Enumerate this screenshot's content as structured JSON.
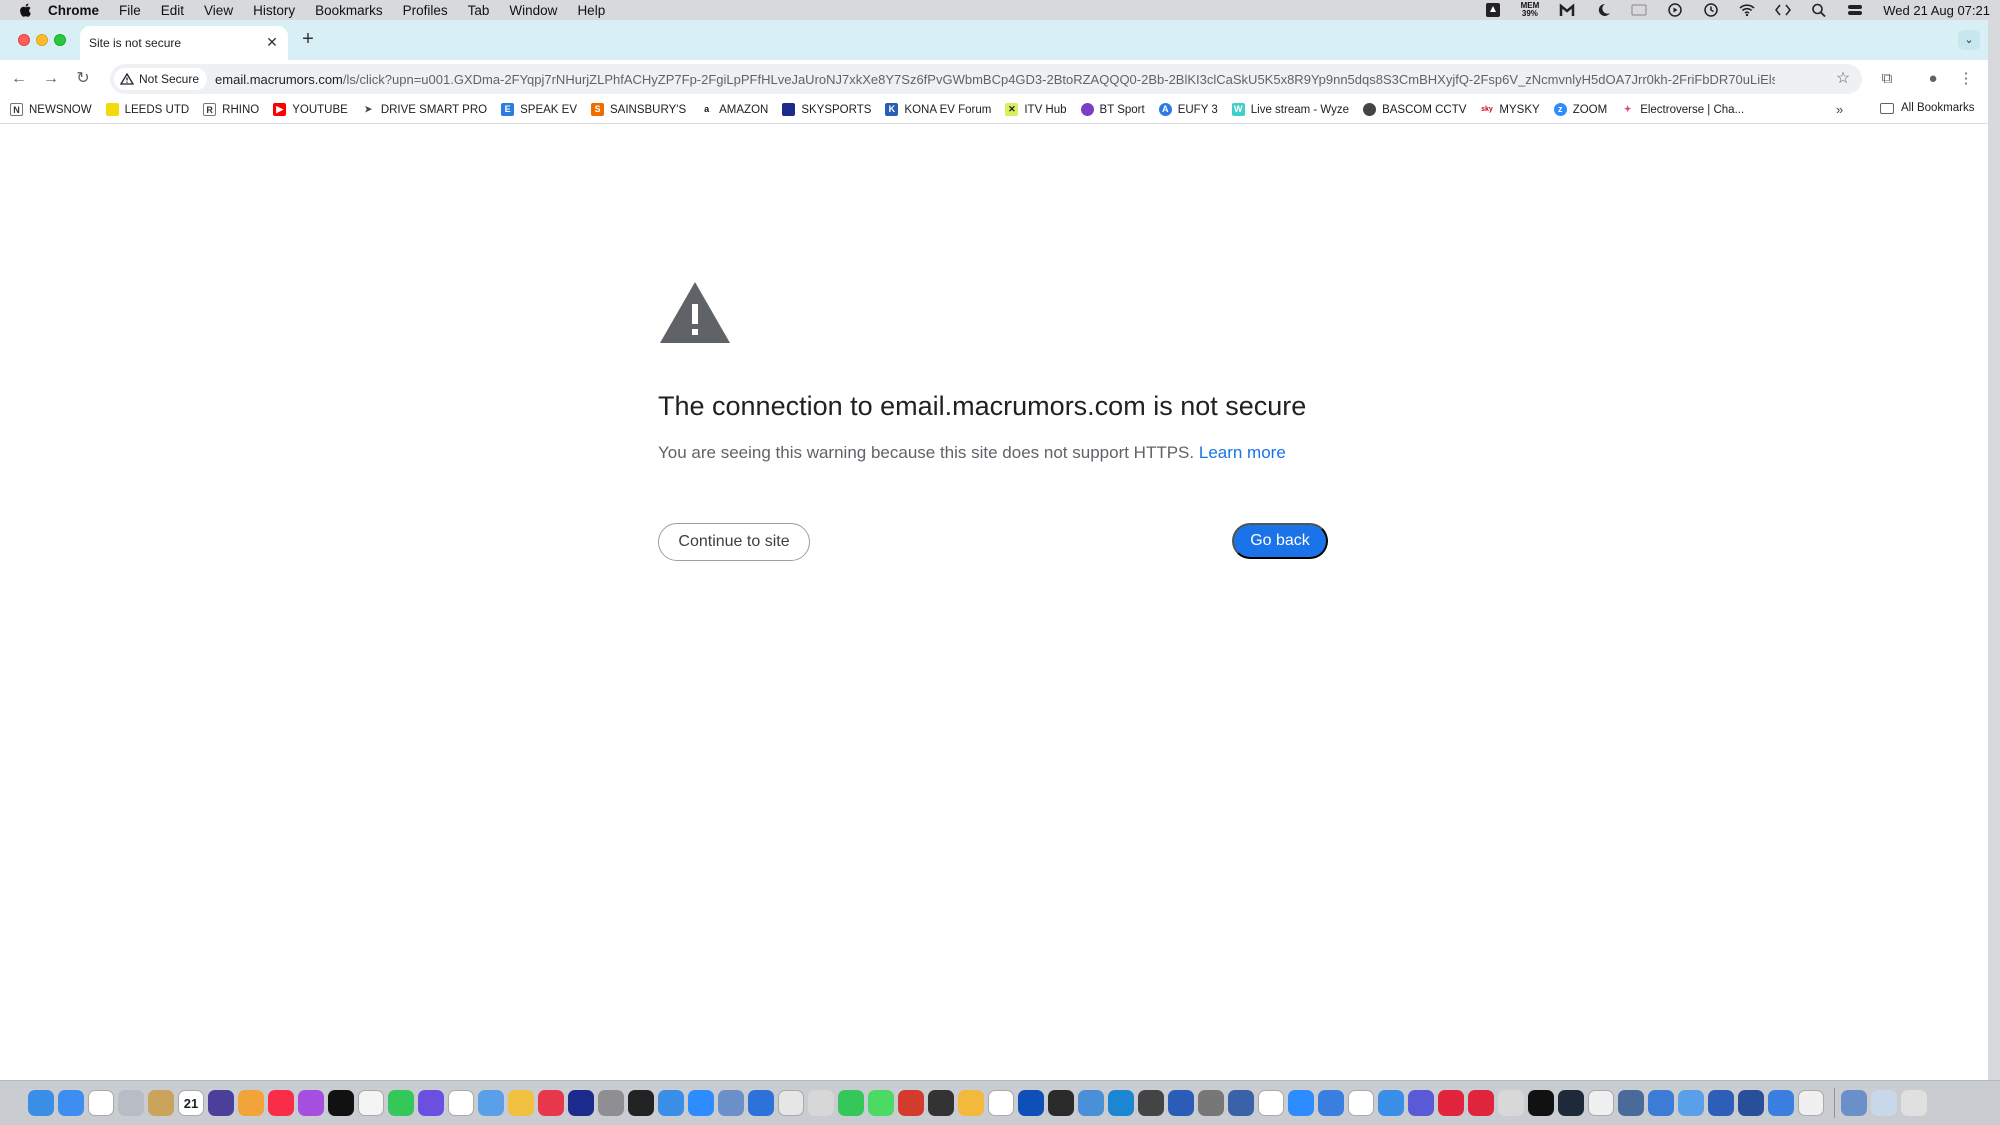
{
  "menubar": {
    "app": "Chrome",
    "items": [
      "File",
      "Edit",
      "View",
      "History",
      "Bookmarks",
      "Profiles",
      "Tab",
      "Window",
      "Help"
    ],
    "mem_label": "MEM",
    "mem_value": "39%",
    "clock": "Wed 21 Aug  07:21"
  },
  "tab": {
    "title": "Site is not secure"
  },
  "toolbar": {
    "security_chip": "Not Secure",
    "url_host": "email.macrumors.com",
    "url_path": "/ls/click?upn=u001.GXDma-2FYqpj7rNHurjZLPhfACHyZP7Fp-2FgiLpPFfHLveJaUroNJ7xkXe8Y7Sz6fPvGWbmBCp4GD3-2BtoRZAQQQ0-2Bb-2BlKI3clCaSkU5K5x8R9Yp9nn5dqs8S3CmBHXyjfQ-2Fsp6V_zNcmvnlyH5dOA7Jrr0kh-2FriFbDR70uLiElsEFY..."
  },
  "bookmarks": {
    "items": [
      {
        "label": "NEWSNOW",
        "color": "#ffffff",
        "glyph": "N",
        "glyph_color": "#333333"
      },
      {
        "label": "LEEDS UTD",
        "color": "#f5d90a",
        "glyph": "",
        "glyph_color": "#ffffff"
      },
      {
        "label": "RHINO",
        "color": "#ffffff",
        "glyph": "R",
        "glyph_color": "#333333"
      },
      {
        "label": "YOUTUBE",
        "color": "#ff0000",
        "glyph": "▶",
        "glyph_color": "#ffffff"
      },
      {
        "label": "DRIVE SMART PRO",
        "color": "#ffffff",
        "glyph": "➤",
        "glyph_color": "#444444"
      },
      {
        "label": "SPEAK EV",
        "color": "#2a7de1",
        "glyph": "E",
        "glyph_color": "#ffffff"
      },
      {
        "label": "SAINSBURY'S",
        "color": "#f06c00",
        "glyph": "S",
        "glyph_color": "#ffffff"
      },
      {
        "label": "AMAZON",
        "color": "#ffffff",
        "glyph": "a",
        "glyph_color": "#111111"
      },
      {
        "label": "SKYSPORTS",
        "color": "#1b2a8c",
        "glyph": "",
        "glyph_color": "#ffffff"
      },
      {
        "label": "KONA EV Forum",
        "color": "#2b5db8",
        "glyph": "K",
        "glyph_color": "#ffffff"
      },
      {
        "label": "ITV Hub",
        "color": "#d8f060",
        "glyph": "✕",
        "glyph_color": "#222222"
      },
      {
        "label": "BT Sport",
        "color": "#7b3fc4",
        "glyph": "",
        "glyph_color": "#ffffff"
      },
      {
        "label": "EUFY 3",
        "color": "#2c7be5",
        "glyph": "A",
        "glyph_color": "#ffffff"
      },
      {
        "label": "Live stream - Wyze",
        "color": "#3fd0c9",
        "glyph": "W",
        "glyph_color": "#ffffff"
      },
      {
        "label": "BASCOM CCTV",
        "color": "#444444",
        "glyph": "",
        "glyph_color": "#ffffff"
      },
      {
        "label": "MYSKY",
        "color": "#ffffff",
        "glyph": "sky",
        "glyph_color": "#d0021b"
      },
      {
        "label": "ZOOM",
        "color": "#2d8cff",
        "glyph": "z",
        "glyph_color": "#ffffff"
      },
      {
        "label": "Electroverse | Cha...",
        "color": "#ffffff",
        "glyph": "✦",
        "glyph_color": "#e0457b"
      }
    ],
    "more": "»",
    "all_bookmarks": "All Bookmarks"
  },
  "interstitial": {
    "heading": "The connection to email.macrumors.com is not secure",
    "explanation": "You are seeing this warning because this site does not support HTTPS.",
    "learn_more": "Learn more",
    "continue_label": "Continue to site",
    "back_label": "Go back"
  },
  "dock": {
    "calendar_day": "21",
    "icons": [
      {
        "name": "finder",
        "color": "#3a8ee6"
      },
      {
        "name": "mail",
        "color": "#3d8ef0"
      },
      {
        "name": "chrome",
        "color": "#ffffff"
      },
      {
        "name": "launchpad",
        "color": "#b8bcc4"
      },
      {
        "name": "archive",
        "color": "#c9a45a"
      },
      {
        "name": "calendar",
        "color": "#ffffff"
      },
      {
        "name": "siri",
        "color": "#4b3f9c"
      },
      {
        "name": "garageband",
        "color": "#f2a33a"
      },
      {
        "name": "music",
        "color": "#fa2d48"
      },
      {
        "name": "podcasts",
        "color": "#a54ee0"
      },
      {
        "name": "tv",
        "color": "#111111"
      },
      {
        "name": "notes",
        "color": "#f4f4f4"
      },
      {
        "name": "messages",
        "color": "#34c759"
      },
      {
        "name": "imovie",
        "color": "#6b4fe0"
      },
      {
        "name": "reminders",
        "color": "#ffffff"
      },
      {
        "name": "preview",
        "color": "#5aa0e8"
      },
      {
        "name": "photos",
        "color": "#f0c040"
      },
      {
        "name": "news",
        "color": "#e8374a"
      },
      {
        "name": "skysports",
        "color": "#1b2a8c"
      },
      {
        "name": "settings",
        "color": "#8e8e93"
      },
      {
        "name": "activity",
        "color": "#222222"
      },
      {
        "name": "safari",
        "color": "#3a8ee6"
      },
      {
        "name": "zoom",
        "color": "#2d8cff"
      },
      {
        "name": "mail-alt",
        "color": "#6a8fc9"
      },
      {
        "name": "proxyman",
        "color": "#2d72d9"
      },
      {
        "name": "scanner",
        "color": "#e6e6e6"
      },
      {
        "name": "preview-2",
        "color": "#d7d7d7"
      },
      {
        "name": "facetime",
        "color": "#34c759"
      },
      {
        "name": "maps",
        "color": "#4cd964"
      },
      {
        "name": "toolbox",
        "color": "#d33b2c"
      },
      {
        "name": "terminal-man",
        "color": "#333333"
      },
      {
        "name": "pencil",
        "color": "#f3b93d"
      },
      {
        "name": "onion",
        "color": "#ffffff"
      },
      {
        "name": "malwarebytes",
        "color": "#0f4fb8"
      },
      {
        "name": "bat",
        "color": "#2a2a2a"
      },
      {
        "name": "editor",
        "color": "#4a90d9"
      },
      {
        "name": "edge",
        "color": "#1b86d1"
      },
      {
        "name": "cyberduck",
        "color": "#444444"
      },
      {
        "name": "xcode",
        "color": "#2b5db8"
      },
      {
        "name": "transmit",
        "color": "#777777"
      },
      {
        "name": "automator",
        "color": "#3b62a8"
      },
      {
        "name": "drive",
        "color": "#ffffff"
      },
      {
        "name": "appstore",
        "color": "#2d8cff"
      },
      {
        "name": "notify",
        "color": "#3a7fe0"
      },
      {
        "name": "slack",
        "color": "#ffffff"
      },
      {
        "name": "focus",
        "color": "#3a8ee6"
      },
      {
        "name": "vpn",
        "color": "#5a5ad6"
      },
      {
        "name": "opera",
        "color": "#e0243b"
      },
      {
        "name": "vivaldi",
        "color": "#e0243b"
      },
      {
        "name": "tools",
        "color": "#d8d8d8"
      },
      {
        "name": "terminal",
        "color": "#111111"
      },
      {
        "name": "quicktime",
        "color": "#1e2a3a"
      },
      {
        "name": "printer",
        "color": "#f0f0f0"
      },
      {
        "name": "screens",
        "color": "#4a6a9a"
      },
      {
        "name": "network",
        "color": "#3c7bd6"
      },
      {
        "name": "migration",
        "color": "#5aa0e8"
      },
      {
        "name": "remote",
        "color": "#2d5fb8"
      },
      {
        "name": "editor-2",
        "color": "#2a4f9a"
      },
      {
        "name": "desktop",
        "color": "#3a7fe0"
      },
      {
        "name": "files",
        "color": "#f0f0f0"
      },
      {
        "name": "preview-3",
        "color": "#6a8fc9"
      },
      {
        "name": "folder",
        "color": "#c8d8ea"
      },
      {
        "name": "trash",
        "color": "#e0e0e0"
      }
    ]
  }
}
